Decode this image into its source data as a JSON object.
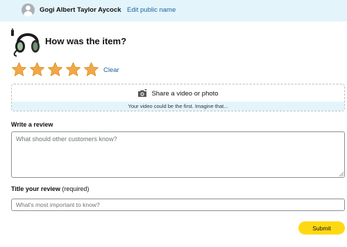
{
  "header": {
    "username": "Gogi Albert Taylor Aycock",
    "edit_link": "Edit public name",
    "avatar_icon": "user-avatar-icon"
  },
  "product": {
    "question": "How was the item?",
    "thumbnail_icon": "headset-icon"
  },
  "rating": {
    "value": 5,
    "max": 5,
    "star_color": "#f3a847",
    "clear_label": "Clear"
  },
  "media": {
    "label": "Share a video or photo",
    "hint": "Your video could be the first. Imagine that...",
    "icon": "camera-plus-icon"
  },
  "review": {
    "label": "Write a review",
    "placeholder": "What should other customers know?",
    "value": ""
  },
  "title": {
    "label": "Title your review",
    "required_note": "(required)",
    "placeholder": "What's most important to know?",
    "value": ""
  },
  "submit": {
    "label": "Submit",
    "color": "#ffd814"
  },
  "colors": {
    "header_bg": "#e3f4fb",
    "link": "#2162a1"
  }
}
